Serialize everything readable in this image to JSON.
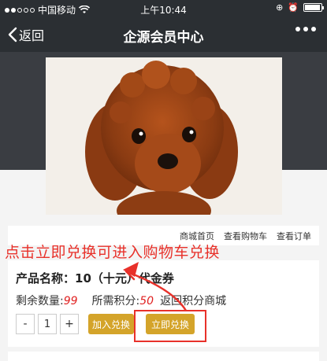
{
  "status_bar": {
    "carrier": "中国移动",
    "time": "上午10:44",
    "battery_level": 0.95,
    "icons": [
      "signal-dots",
      "wifi-icon",
      "lock-rotation-icon",
      "alarm-icon",
      "battery-icon"
    ]
  },
  "navbar": {
    "back_label": "返回",
    "title": "企源会员中心",
    "more_icon": "ellipsis-icon"
  },
  "links": {
    "home": "商城首页",
    "cart": "查看购物车",
    "orders": "查看订单"
  },
  "annotation": {
    "text": "点击立即兑换可进入购物车兑换",
    "color": "#e8312a"
  },
  "product": {
    "name_label": "产品名称：",
    "name": "10（十元）代金券",
    "remaining_label": "剩余数量:",
    "remaining": "99",
    "points_label": "所需积分:",
    "points": "50",
    "back_mall": "返回积分商城",
    "qty_minus": "-",
    "qty_value": "1",
    "qty_plus": "+",
    "add_button": "加入兑换",
    "redeem_button": "立即兑换"
  },
  "colors": {
    "nav_bg": "#2b2f33",
    "accent_gold": "#d4a42a",
    "annotation_red": "#e8312a"
  }
}
